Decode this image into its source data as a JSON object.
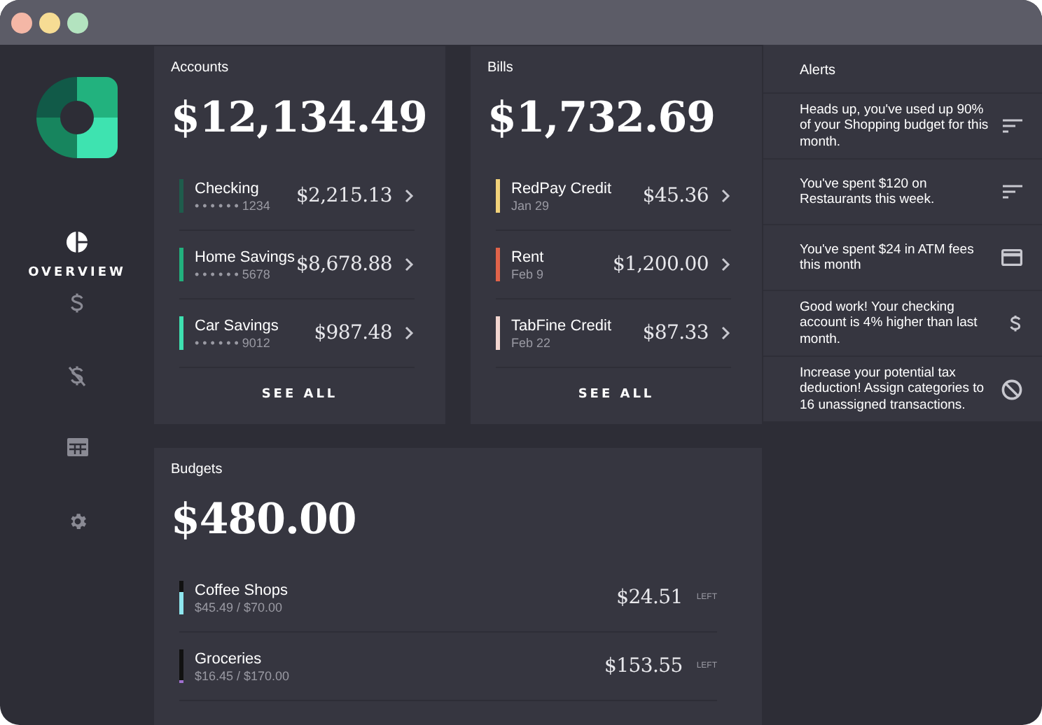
{
  "sidebar": {
    "items": [
      {
        "label": "OVERVIEW",
        "selected": true
      },
      {
        "selected": false
      },
      {
        "selected": false
      },
      {
        "selected": false
      },
      {
        "selected": false
      }
    ]
  },
  "accounts": {
    "title": "Accounts",
    "total": "$12,134.49",
    "rows": [
      {
        "name": "Checking",
        "detail": "• • • • • • 1234",
        "amount": "$2,215.13",
        "color": "#1f5c4c"
      },
      {
        "name": "Home Savings",
        "detail": "• • • • • • 5678",
        "amount": "$8,678.88",
        "color": "#22b07d"
      },
      {
        "name": "Car Savings",
        "detail": "• • • • • • 9012",
        "amount": "$987.48",
        "color": "#3ee0b0"
      }
    ],
    "action": "SEE ALL"
  },
  "bills": {
    "title": "Bills",
    "total": "$1,732.69",
    "rows": [
      {
        "name": "RedPay Credit",
        "detail": "Jan 29",
        "amount": "$45.36",
        "color": "#f2d27a"
      },
      {
        "name": "Rent",
        "detail": "Feb 9",
        "amount": "$1,200.00",
        "color": "#e0634a"
      },
      {
        "name": "TabFine Credit",
        "detail": "Feb 22",
        "amount": "$87.33",
        "color": "#f3d6d0"
      }
    ],
    "action": "SEE ALL"
  },
  "alerts": {
    "title": "Alerts",
    "items": [
      {
        "text": "Heads up, you've used up 90% of your Shopping budget for this month."
      },
      {
        "text": "You've spent $120 on Restaurants this week."
      },
      {
        "text": "You've spent $24 in ATM fees this month"
      },
      {
        "text": "Good work! Your checking account is 4% higher than last month."
      },
      {
        "text": "Increase your potential tax deduction! Assign categories to 16 unassigned transactions."
      }
    ]
  },
  "budgets": {
    "title": "Budgets",
    "total": "$480.00",
    "rows": [
      {
        "name": "Coffee Shops",
        "detail": "$45.49 / $70.00",
        "amount": "$24.51",
        "suffix": "LEFT",
        "color": "#8ee6ee",
        "level": 0.65
      },
      {
        "name": "Groceries",
        "detail": "$16.45 / $170.00",
        "amount": "$153.55",
        "suffix": "LEFT",
        "color": "#a070d0",
        "level": 0.1
      }
    ]
  }
}
